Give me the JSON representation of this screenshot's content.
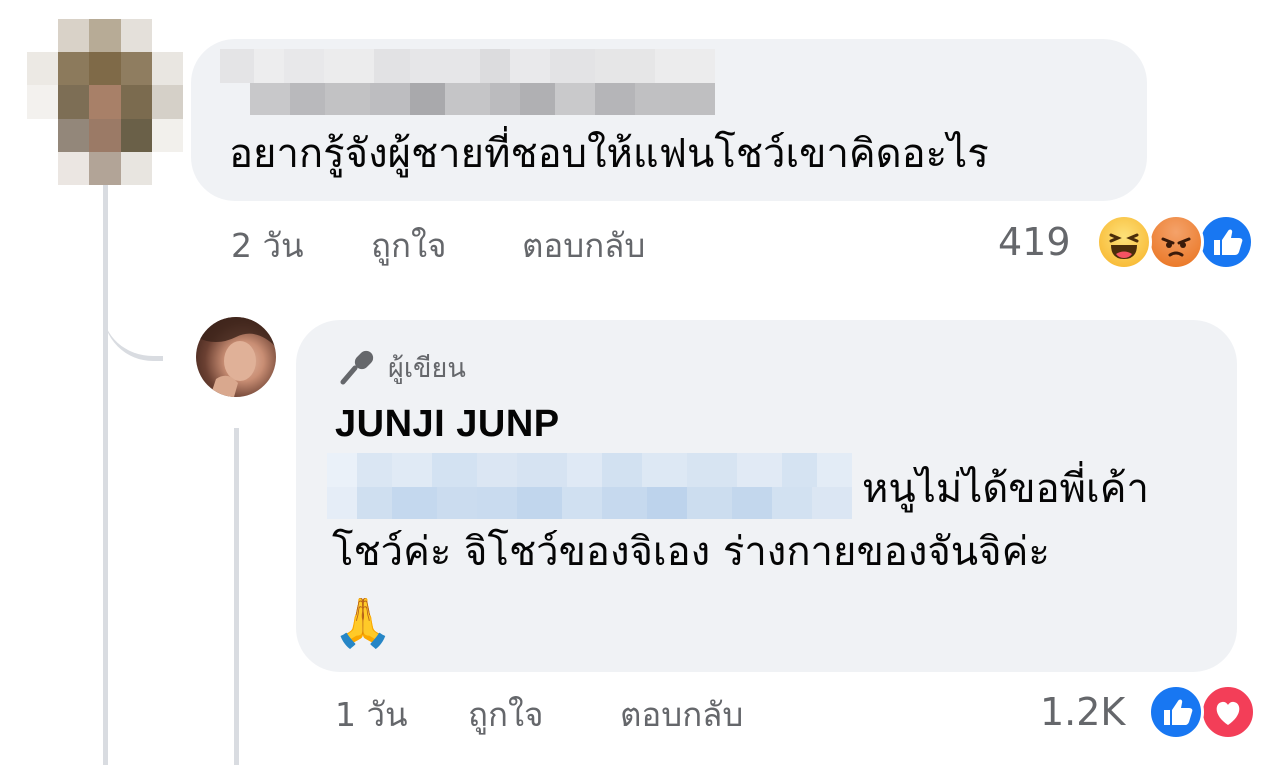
{
  "comment": {
    "text": "อยากรู้จังผู้ชายที่ชอบให้แฟนโชว์เขาคิดอะไร",
    "time": "2 วัน",
    "like_label": "ถูกใจ",
    "reply_label": "ตอบกลับ",
    "reaction_count": "419",
    "reactions": [
      "haha-icon",
      "angry-icon",
      "like-icon"
    ]
  },
  "reply": {
    "badge_label": "ผู้เขียน",
    "author": "JUNJI JUNP",
    "text_line1": "หนูไม่ได้ขอพี่เค้า",
    "text_line2": "โชว์ค่ะ จิโชว์ของจิเอง ร่างกายของจันจิค่ะ",
    "emoji": "🙏",
    "time": "1 วัน",
    "like_label": "ถูกใจ",
    "reply_label": "ตอบกลับ",
    "reaction_count": "1.2K",
    "reactions": [
      "like-icon",
      "love-icon"
    ]
  },
  "colors": {
    "bubble": "#f0f2f5",
    "meta_text": "#65676b",
    "like_blue": "#1877f2",
    "love_red": "#f33e58",
    "emoji_yellow": "#f7b125"
  }
}
